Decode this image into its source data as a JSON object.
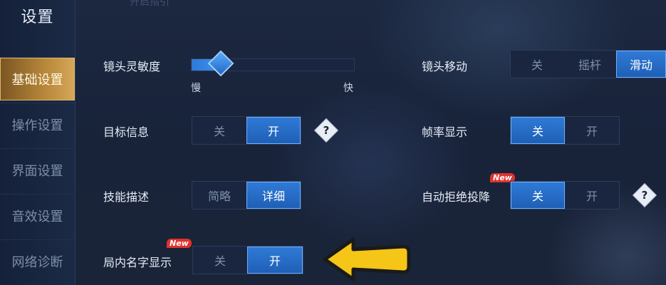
{
  "sidebar": {
    "title": "设置",
    "items": [
      {
        "label": "基础设置",
        "active": true
      },
      {
        "label": "操作设置",
        "active": false
      },
      {
        "label": "界面设置",
        "active": false
      },
      {
        "label": "音效设置",
        "active": false
      },
      {
        "label": "网络诊断",
        "active": false
      }
    ]
  },
  "top_hint": "开启指引",
  "camera_sensitivity": {
    "label": "镜头灵敏度",
    "min_label": "慢",
    "max_label": "快",
    "value": 0.18
  },
  "camera_move": {
    "label": "镜头移动",
    "options": [
      "关",
      "摇杆",
      "滑动"
    ],
    "selected": "滑动"
  },
  "target_info": {
    "label": "目标信息",
    "options": [
      "关",
      "开"
    ],
    "selected": "开",
    "help": "?"
  },
  "frame_rate": {
    "label": "帧率显示",
    "options": [
      "关",
      "开"
    ],
    "selected": "关"
  },
  "skill_desc": {
    "label": "技能描述",
    "options": [
      "简略",
      "详细"
    ],
    "selected": "详细"
  },
  "auto_reject": {
    "label": "自动拒绝投降",
    "badge": "New",
    "options": [
      "关",
      "开"
    ],
    "selected": "关",
    "help": "?"
  },
  "show_names": {
    "label": "局内名字显示",
    "badge": "New",
    "options": [
      "关",
      "开"
    ],
    "selected": "开"
  },
  "colors": {
    "accent": "#2f7ad6",
    "sidebar_active": "#b8873a",
    "arrow": "#f5c518",
    "badge": "#e0322c"
  }
}
